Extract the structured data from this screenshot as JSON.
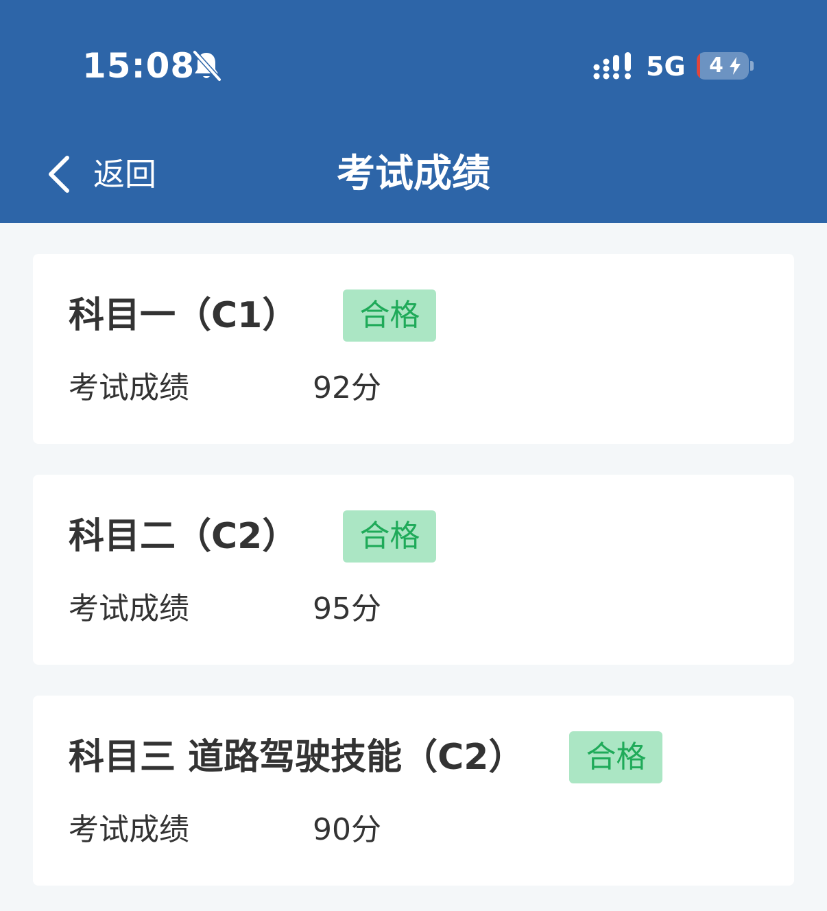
{
  "status_bar": {
    "time": "15:08",
    "network": "5G",
    "battery": "4"
  },
  "nav": {
    "back_label": "返回",
    "title": "考试成绩"
  },
  "results": [
    {
      "subject": "科目一（C1）",
      "status": "合格",
      "score_label": "考试成绩",
      "score": "92分"
    },
    {
      "subject": "科目二（C2）",
      "status": "合格",
      "score_label": "考试成绩",
      "score": "95分"
    },
    {
      "subject": "科目三 道路驾驶技能（C2）",
      "status": "合格",
      "score_label": "考试成绩",
      "score": "90分"
    }
  ],
  "colors": {
    "header_bg": "#2d65a8",
    "page_bg": "#f4f7f9",
    "pass_badge_bg": "#abe6c4",
    "pass_badge_text": "#1faa59",
    "text": "#333333"
  }
}
